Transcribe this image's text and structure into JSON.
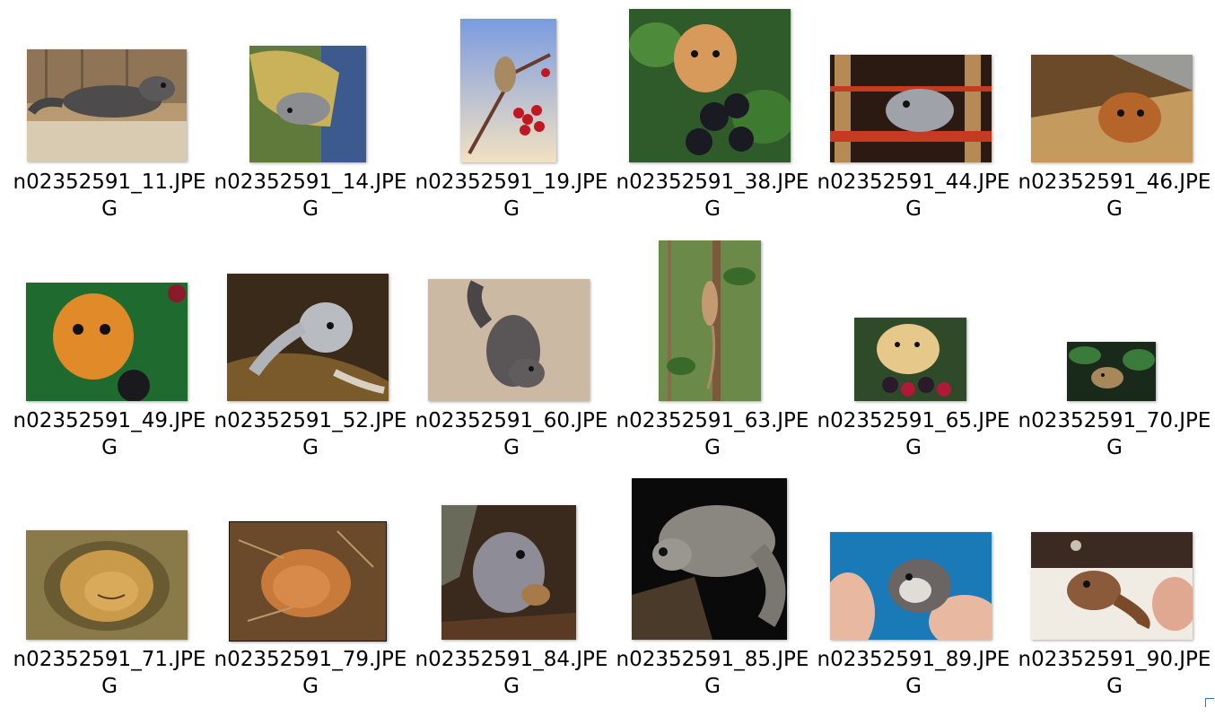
{
  "view": {
    "icon_kind": "photo-thumbnail-icon",
    "files": [
      {
        "name": "n02352591_11.JPEG"
      },
      {
        "name": "n02352591_14.JPEG"
      },
      {
        "name": "n02352591_19.JPEG"
      },
      {
        "name": "n02352591_38.JPEG"
      },
      {
        "name": "n02352591_44.JPEG"
      },
      {
        "name": "n02352591_46.JPEG"
      },
      {
        "name": "n02352591_49.JPEG"
      },
      {
        "name": "n02352591_52.JPEG"
      },
      {
        "name": "n02352591_60.JPEG"
      },
      {
        "name": "n02352591_63.JPEG"
      },
      {
        "name": "n02352591_65.JPEG"
      },
      {
        "name": "n02352591_70.JPEG"
      },
      {
        "name": "n02352591_71.JPEG"
      },
      {
        "name": "n02352591_79.JPEG"
      },
      {
        "name": "n02352591_84.JPEG"
      },
      {
        "name": "n02352591_85.JPEG"
      },
      {
        "name": "n02352591_89.JPEG"
      },
      {
        "name": "n02352591_90.JPEG"
      }
    ]
  }
}
